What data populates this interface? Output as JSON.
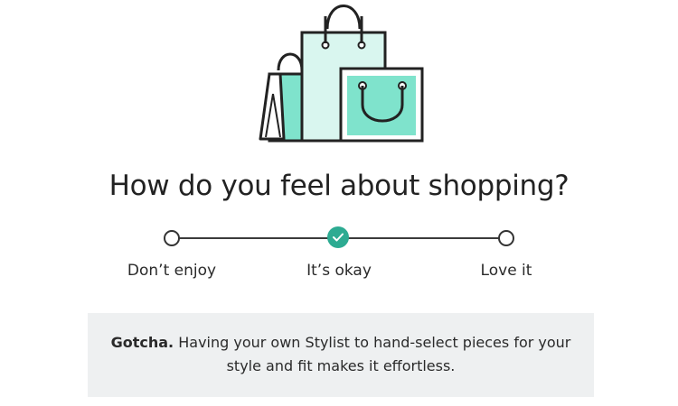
{
  "illustration": {
    "icon": "shopping-bags-icon",
    "accent_color": "#7fe3cc",
    "light_fill": "#d9f6ef",
    "stroke_color": "#222222"
  },
  "question": "How do you feel about shopping?",
  "scale": {
    "options": [
      {
        "label": "Don’t enjoy",
        "selected": false
      },
      {
        "label": "It’s okay",
        "selected": true
      },
      {
        "label": "Love it",
        "selected": false
      }
    ],
    "selected_color": "#2dab92"
  },
  "feedback": {
    "lead": "Gotcha.",
    "text": "Having your own Stylist to hand-select pieces for your style and fit makes it effortless."
  }
}
